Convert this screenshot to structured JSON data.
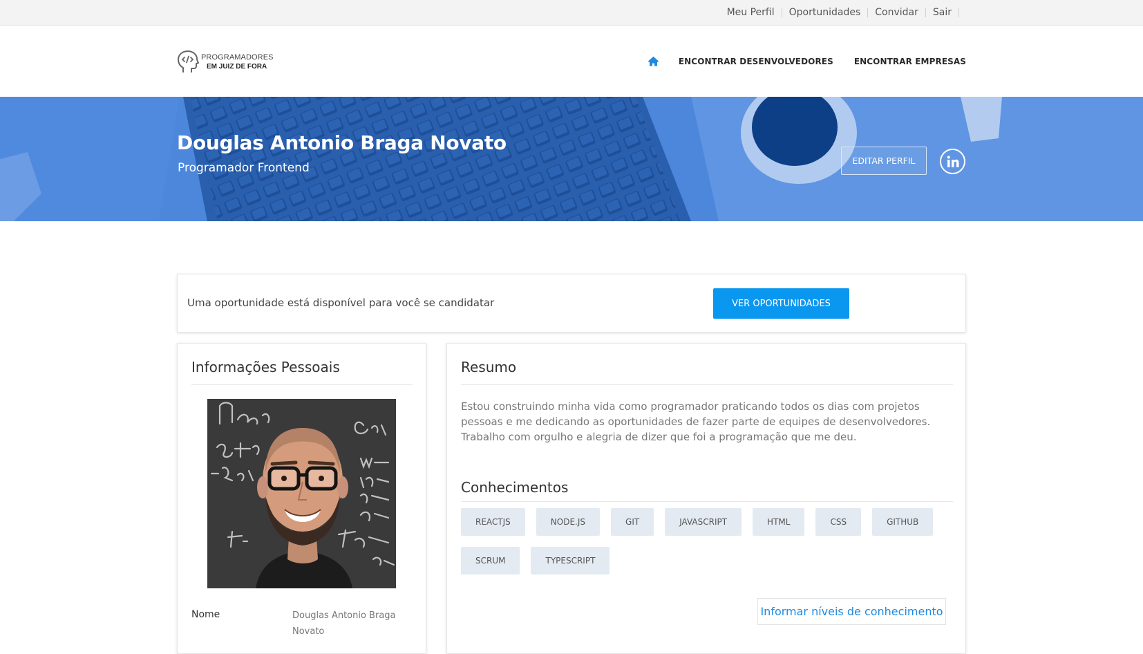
{
  "topbar": {
    "links": [
      "Meu Perfil",
      "Oportunidades",
      "Convidar",
      "Sair"
    ]
  },
  "header": {
    "logo_line1": "PROGRAMADORES",
    "logo_line2": "EM JUIZ DE FORA",
    "home_icon": "home-icon",
    "nav": [
      "ENCONTRAR DESENVOLVEDORES",
      "ENCONTRAR EMPRESAS"
    ]
  },
  "hero": {
    "name": "Douglas Antonio Braga Novato",
    "role": "Programador Frontend",
    "edit_button": "EDITAR PERFIL",
    "social_icon": "linkedin-icon"
  },
  "alert": {
    "text": "Uma oportunidade está disponível para você se candidatar",
    "button": "VER OPORTUNIDADES"
  },
  "personal": {
    "title": "Informações Pessoais",
    "name_label": "Nome",
    "name_value": "Douglas Antonio Braga Novato"
  },
  "summary": {
    "title": "Resumo",
    "text": "Estou construindo minha vida como programador praticando todos os dias com projetos pessoas e me dedicando as oportunidades de fazer parte de equipes de desenvolvedores. Trabalho com orgulho e alegria de dizer que foi a programação que me deu.",
    "skills_title": "Conhecimentos",
    "skills": [
      "REACTJS",
      "NODE.JS",
      "GIT",
      "JAVASCRIPT",
      "HTML",
      "CSS",
      "GITHUB",
      "SCRUM",
      "TYPESCRIPT"
    ],
    "levels_button": "Informar níveis de conhecimento"
  },
  "colors": {
    "hero_blue": "#4a86dd",
    "primary_button": "#0a97f0",
    "skill_chip": "#e4eaf1",
    "link_blue": "#1e8ae0",
    "home_icon": "#1e8ae0"
  }
}
